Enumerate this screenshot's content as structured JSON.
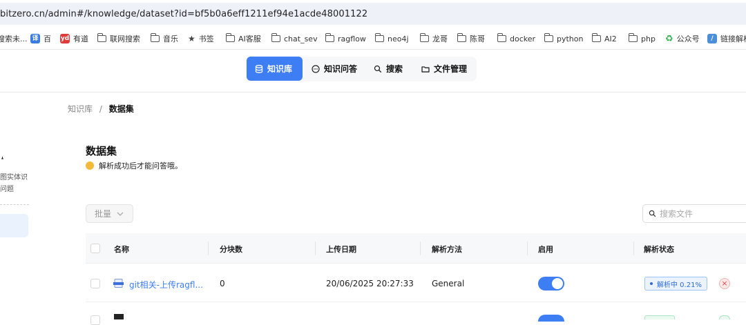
{
  "browser": {
    "url": "bitzero.cn/admin#/knowledge/dataset?id=bf5b0a6eff1211ef94e1acde48001122"
  },
  "bookmarks": [
    {
      "label": "搜索未...",
      "icon": "partial-icon"
    },
    {
      "label": "百",
      "icon": "translate-icon",
      "color": "#3a7be0"
    },
    {
      "label": "有道",
      "icon": "youdao-icon",
      "color": "#e03a3a"
    },
    {
      "label": "联网搜索",
      "icon": "folder-icon"
    },
    {
      "label": "音乐",
      "icon": "folder-icon"
    },
    {
      "label": "书签",
      "icon": "star-icon"
    },
    {
      "label": "AI客服",
      "icon": "folder-icon"
    },
    {
      "label": "chat_sev",
      "icon": "folder-icon"
    },
    {
      "label": "ragflow",
      "icon": "folder-icon"
    },
    {
      "label": "neo4j",
      "icon": "folder-icon"
    },
    {
      "label": "龙哥",
      "icon": "folder-icon"
    },
    {
      "label": "陈哥",
      "icon": "folder-icon"
    },
    {
      "label": "docker",
      "icon": "folder-icon"
    },
    {
      "label": "python",
      "icon": "folder-icon"
    },
    {
      "label": "AI2",
      "icon": "folder-icon"
    },
    {
      "label": "php",
      "icon": "folder-icon"
    },
    {
      "label": "公众号",
      "icon": "wechat-icon",
      "color": "#2bb24c"
    },
    {
      "label": "链接解析",
      "icon": "link-icon"
    }
  ],
  "topnav": {
    "items": [
      {
        "label": "知识库",
        "icon": "database-icon",
        "active": true
      },
      {
        "label": "知识问答",
        "icon": "chat-icon",
        "active": false
      },
      {
        "label": "搜索",
        "icon": "search-icon",
        "active": false
      },
      {
        "label": "文件管理",
        "icon": "folder-icon",
        "active": false
      }
    ],
    "accent": "#3d7ef5"
  },
  "breadcrumb": {
    "root": "知识库",
    "separator": "/",
    "current": "数据集"
  },
  "sidebar": {
    "partial_text_1": "图实体识",
    "partial_text_2": "问题"
  },
  "dataset": {
    "title": "数据集",
    "subtitle": "解析成功后才能问答哦。"
  },
  "toolbar": {
    "batch_label": "批量",
    "search_placeholder": "搜索文件"
  },
  "table": {
    "columns": [
      "名称",
      "分块数",
      "上传日期",
      "解析方法",
      "启用",
      "解析状态"
    ],
    "rows": [
      {
        "name": "git相关-上传ragfl...",
        "chunks": "0",
        "upload_date": "20/06/2025 20:27:33",
        "method": "General",
        "enabled": true,
        "status": "解析中  0.21%",
        "status_color": "#2d6bd8"
      }
    ]
  }
}
